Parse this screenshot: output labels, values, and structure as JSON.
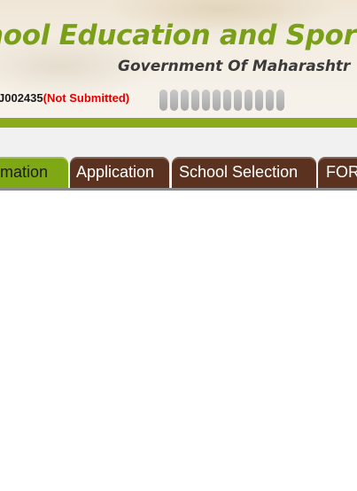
{
  "header": {
    "title": "hool Education and Sport",
    "subtitle": "Government Of Maharashtr"
  },
  "application": {
    "id": "J002435",
    "status": "(Not Submitted)",
    "progress_segments": 12
  },
  "tabs": [
    {
      "label": "mation",
      "active": true
    },
    {
      "label": "Application",
      "active": false
    },
    {
      "label": "School Selection",
      "active": false
    },
    {
      "label": "FOR",
      "active": false
    }
  ],
  "colors": {
    "brand_green": "#7ea814",
    "tab_brown": "#5b3220",
    "status_red": "#e00000"
  }
}
